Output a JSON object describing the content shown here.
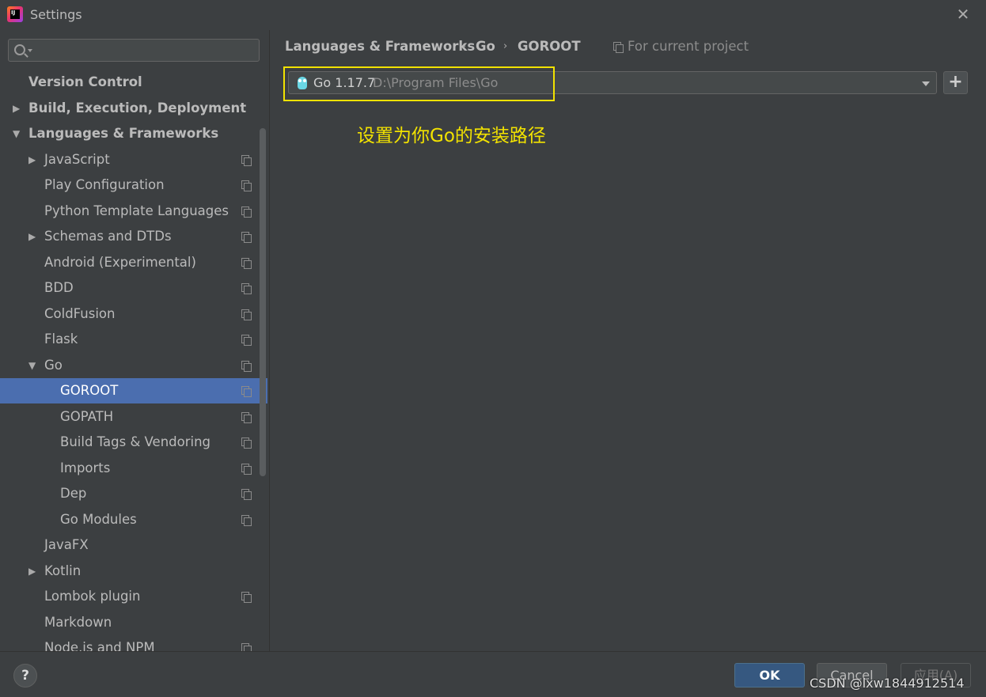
{
  "window": {
    "title": "Settings",
    "close_glyph": "✕"
  },
  "sidebar": {
    "search": {
      "placeholder": "",
      "value": ""
    },
    "items": [
      {
        "label": "Version Control",
        "bold": true
      },
      {
        "label": "Build, Execution, Deployment",
        "bold": true,
        "expander": "▶"
      },
      {
        "label": "Languages & Frameworks",
        "bold": true,
        "expander": "▼"
      },
      {
        "label": "JavaScript",
        "expander": "▶"
      },
      {
        "label": "Play Configuration"
      },
      {
        "label": "Python Template Languages"
      },
      {
        "label": "Schemas and DTDs",
        "expander": "▶"
      },
      {
        "label": "Android (Experimental)"
      },
      {
        "label": "BDD"
      },
      {
        "label": "ColdFusion"
      },
      {
        "label": "Flask"
      },
      {
        "label": "Go",
        "expander": "▼"
      },
      {
        "label": "GOROOT",
        "selected": true
      },
      {
        "label": "GOPATH"
      },
      {
        "label": "Build Tags & Vendoring"
      },
      {
        "label": "Imports"
      },
      {
        "label": "Dep"
      },
      {
        "label": "Go Modules"
      },
      {
        "label": "JavaFX"
      },
      {
        "label": "Kotlin",
        "expander": "▶"
      },
      {
        "label": "Lombok plugin"
      },
      {
        "label": "Markdown"
      },
      {
        "label": "Node.js and NPM"
      }
    ]
  },
  "main": {
    "breadcrumb": [
      "Languages & Frameworks",
      "Go",
      "GOROOT"
    ],
    "breadcrumb_separator": "›",
    "scope_label": "For current project",
    "sdk": {
      "version": "Go 1.17.7",
      "path": "D:\\Program Files\\Go"
    },
    "add_glyph": "+",
    "annotation": "设置为你Go的安装路径",
    "annotation_color": "#f2e200"
  },
  "footer": {
    "help_glyph": "?",
    "ok_label": "OK",
    "cancel_label": "Cancel",
    "apply_label": "应用(A)",
    "watermark": "CSDN @lxw1844912514"
  },
  "colors": {
    "background": "#3c3f41",
    "selection": "#4b6eaf",
    "ok_button": "#365880"
  }
}
